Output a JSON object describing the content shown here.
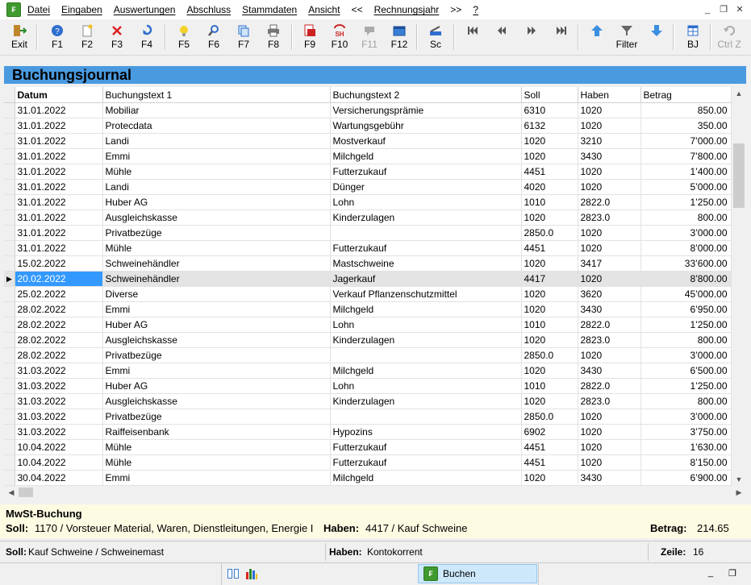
{
  "menu": {
    "items": [
      "Datei",
      "Eingaben",
      "Auswertungen",
      "Abschluss",
      "Stammdaten",
      "Ansicht",
      "<<",
      "Rechnungsjahr",
      ">>",
      "?"
    ]
  },
  "toolbar": {
    "exit": "Exit",
    "f1": "F1",
    "f2": "F2",
    "f3": "F3",
    "f4": "F4",
    "f5": "F5",
    "f6": "F6",
    "f7": "F7",
    "f8": "F8",
    "f9": "F9",
    "f10": "F10",
    "f11": "F11",
    "f12": "F12",
    "sc": "Sc",
    "filter": "Filter",
    "bj": "BJ",
    "ctrlz": "Ctrl Z",
    "sh_badge": "SH"
  },
  "panel": {
    "title": "Buchungsjournal"
  },
  "table": {
    "headers": [
      "Datum",
      "Buchungstext 1",
      "Buchungstext 2",
      "Soll",
      "Haben",
      "Betrag"
    ],
    "rows": [
      [
        "31.01.2022",
        "Mobiliar",
        "Versicherungsprämie",
        "6310",
        "1020",
        "850.00"
      ],
      [
        "31.01.2022",
        "Protecdata",
        "Wartungsgebühr",
        "6132",
        "1020",
        "350.00"
      ],
      [
        "31.01.2022",
        "Landi",
        "Mostverkauf",
        "1020",
        "3210",
        "7’000.00"
      ],
      [
        "31.01.2022",
        "Emmi",
        "Milchgeld",
        "1020",
        "3430",
        "7’800.00"
      ],
      [
        "31.01.2022",
        "Mühle",
        "Futterzukauf",
        "4451",
        "1020",
        "1’400.00"
      ],
      [
        "31.01.2022",
        "Landi",
        "Dünger",
        "4020",
        "1020",
        "5’000.00"
      ],
      [
        "31.01.2022",
        "Huber AG",
        "Lohn",
        "1010",
        "2822.0",
        "1’250.00"
      ],
      [
        "31.01.2022",
        "Ausgleichskasse",
        "Kinderzulagen",
        "1020",
        "2823.0",
        "800.00"
      ],
      [
        "31.01.2022",
        "Privatbezüge",
        "",
        "2850.0",
        "1020",
        "3’000.00"
      ],
      [
        "31.01.2022",
        "Mühle",
        "Futterzukauf",
        "4451",
        "1020",
        "8’000.00"
      ],
      [
        "15.02.2022",
        "Schweinehändler",
        "Mastschweine",
        "1020",
        "3417",
        "33’600.00"
      ],
      [
        "20.02.2022",
        "Schweinehändler",
        "Jagerkauf",
        "4417",
        "1020",
        "8’800.00"
      ],
      [
        "25.02.2022",
        "Diverse",
        "Verkauf Pflanzenschutzmittel",
        "1020",
        "3620",
        "45’000.00"
      ],
      [
        "28.02.2022",
        "Emmi",
        "Milchgeld",
        "1020",
        "3430",
        "6’950.00"
      ],
      [
        "28.02.2022",
        "Huber AG",
        "Lohn",
        "1010",
        "2822.0",
        "1’250.00"
      ],
      [
        "28.02.2022",
        "Ausgleichskasse",
        "Kinderzulagen",
        "1020",
        "2823.0",
        "800.00"
      ],
      [
        "28.02.2022",
        "Privatbezüge",
        "",
        "2850.0",
        "1020",
        "3’000.00"
      ],
      [
        "31.03.2022",
        "Emmi",
        "Milchgeld",
        "1020",
        "3430",
        "6’500.00"
      ],
      [
        "31.03.2022",
        "Huber AG",
        "Lohn",
        "1010",
        "2822.0",
        "1’250.00"
      ],
      [
        "31.03.2022",
        "Ausgleichskasse",
        "Kinderzulagen",
        "1020",
        "2823.0",
        "800.00"
      ],
      [
        "31.03.2022",
        "Privatbezüge",
        "",
        "2850.0",
        "1020",
        "3’000.00"
      ],
      [
        "31.03.2022",
        "Raiffeisenbank",
        "Hypozins",
        "6902",
        "1020",
        "3’750.00"
      ],
      [
        "10.04.2022",
        "Mühle",
        "Futterzukauf",
        "4451",
        "1020",
        "1’630.00"
      ],
      [
        "10.04.2022",
        "Mühle",
        "Futterzukauf",
        "4451",
        "1020",
        "8’150.00"
      ],
      [
        "30.04.2022",
        "Emmi",
        "Milchgeld",
        "1020",
        "3430",
        "6’900.00"
      ]
    ],
    "selected_row": 11
  },
  "mwst": {
    "title": "MwSt-Buchung",
    "soll_label": "Soll:",
    "soll_value": "1170 / Vorsteuer Material, Waren, Dienstleitungen, Energie I",
    "haben_label": "Haben:",
    "haben_value": "4417 / Kauf Schweine",
    "betrag_label": "Betrag:",
    "betrag_value": "214.65"
  },
  "status": {
    "soll_label": "Soll:",
    "soll_value": "Kauf Schweine / Schweinemast",
    "haben_label": "Haben:",
    "haben_value": "Kontokorrent",
    "zeile_label": "Zeile:",
    "zeile_value": "16"
  },
  "taskbar": {
    "buchen": "Buchen"
  },
  "colors": {
    "panel": "#4a9ae0",
    "selected_date": "#3399ff",
    "mwst_bg": "#fdfbe2"
  }
}
